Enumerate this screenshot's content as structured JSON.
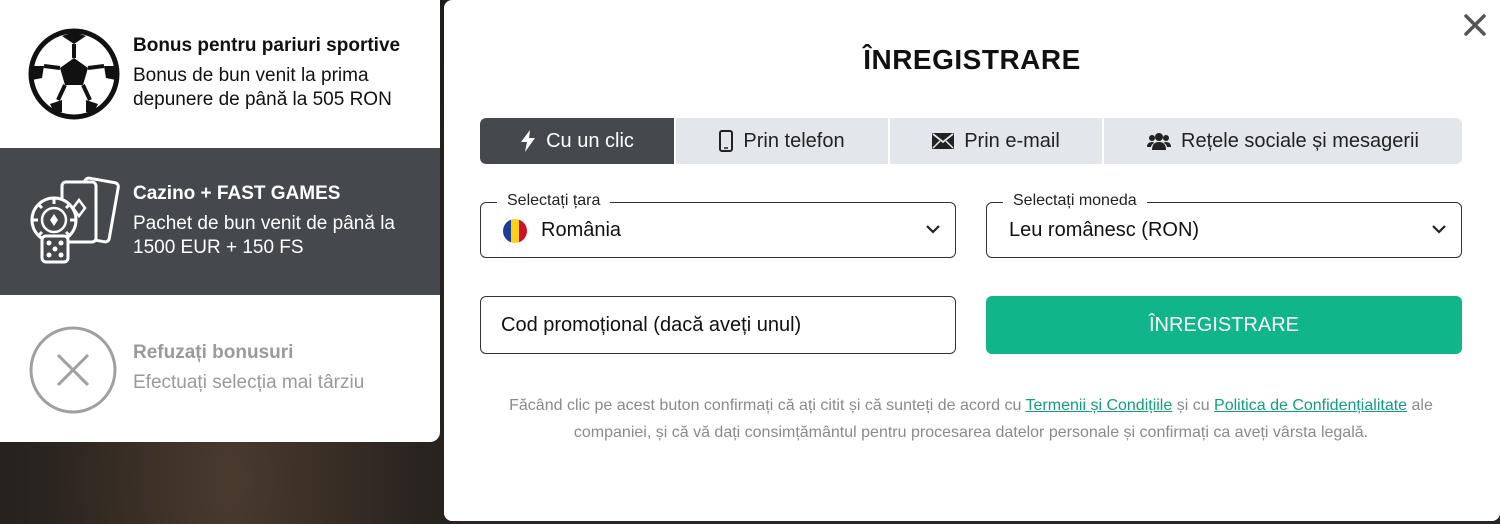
{
  "bonuses": [
    {
      "title": "Bonus pentru pariuri sportive",
      "desc": "Bonus de bun venit la prima depunere de până la 505 RON",
      "icon": "soccer-ball-icon"
    },
    {
      "title": "Cazino + FAST GAMES",
      "desc": "Pachet de bun venit de până la 1500 EUR + 150 FS",
      "icon": "casino-cards-chip-dice-icon"
    },
    {
      "title": "Refuzați bonusuri",
      "desc": "Efectuați selecția mai târziu",
      "icon": "circle-x-icon"
    }
  ],
  "modal": {
    "title": "ÎNREGISTRARE",
    "tabs": [
      {
        "label": "Cu un clic",
        "icon": "lightning-icon"
      },
      {
        "label": "Prin telefon",
        "icon": "phone-icon"
      },
      {
        "label": "Prin e-mail",
        "icon": "envelope-icon"
      },
      {
        "label": "Rețele sociale și mesagerii",
        "icon": "users-icon"
      }
    ],
    "country": {
      "legend": "Selectați țara",
      "value": "România"
    },
    "currency": {
      "legend": "Selectați moneda",
      "value": "Leu românesc (RON)"
    },
    "promo_placeholder": "Cod promoțional (dacă aveți unul)",
    "register_label": "ÎNREGISTRARE",
    "legal": {
      "part1": "Făcând clic pe acest buton confirmați că ați citit și că sunteți de acord cu ",
      "link1": "Termenii și Condițiile",
      "part2": " și cu ",
      "link2": "Politica de Confidențialitate",
      "part3": " ale companiei, și că vă dați consimțământul pentru procesarea datelor personale și confirmați ca aveți vârsta legală."
    }
  },
  "colors": {
    "accent": "#11b58a",
    "active_tab": "#45484c",
    "tab_bg": "#e3e6ea"
  }
}
